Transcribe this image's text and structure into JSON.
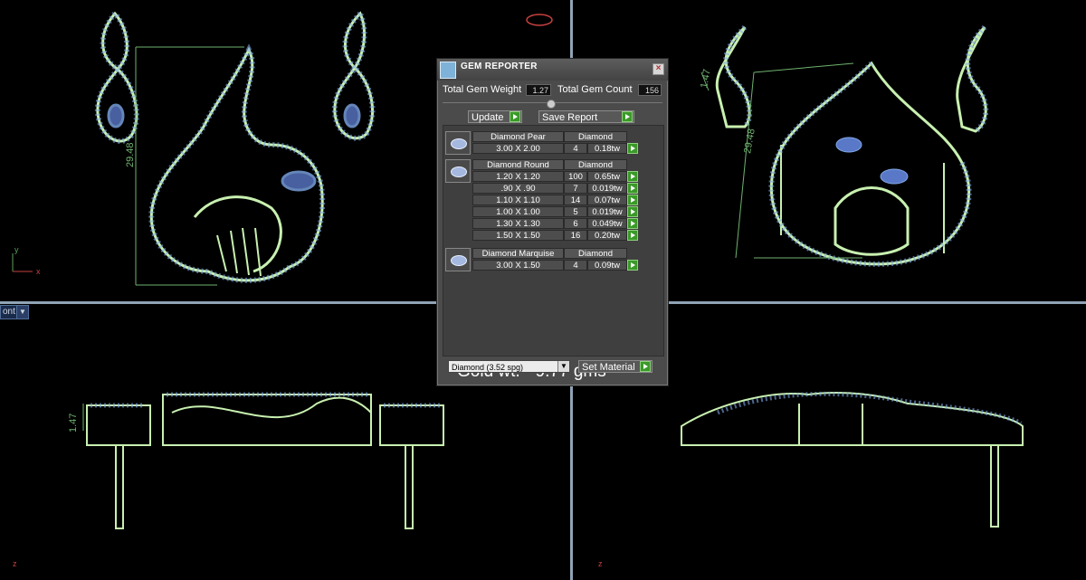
{
  "viewport": {
    "label": "ont",
    "axis_y": "y",
    "axis_x": "x",
    "axis_z": "z",
    "dim_tl": "29.48",
    "dim_tr_height": "29.48",
    "dim_tr_depth": "1.47",
    "dim_bl": "1.47"
  },
  "dialog": {
    "title": "GEM REPORTER",
    "total_weight_label": "Total Gem Weight",
    "total_weight": "1.27",
    "total_count_label": "Total Gem Count",
    "total_count": "156",
    "update_label": "Update",
    "save_report_label": "Save Report",
    "groups": [
      {
        "icon": "pear-gem-icon",
        "name": "Diamond Pear",
        "material": "Diamond",
        "rows": [
          {
            "size": "3.00 X 2.00",
            "count": "4",
            "weight": "0.18tw"
          }
        ]
      },
      {
        "icon": "round-gem-icon",
        "name": "Diamond Round",
        "material": "Diamond",
        "rows": [
          {
            "size": "1.20 X 1.20",
            "count": "100",
            "weight": "0.65tw"
          },
          {
            "size": ".90 X .90",
            "count": "7",
            "weight": "0.019tw"
          },
          {
            "size": "1.10 X 1.10",
            "count": "14",
            "weight": "0.07tw"
          },
          {
            "size": "1.00 X 1.00",
            "count": "5",
            "weight": "0.019tw"
          },
          {
            "size": "1.30 X 1.30",
            "count": "6",
            "weight": "0.049tw"
          },
          {
            "size": "1.50 X 1.50",
            "count": "16",
            "weight": "0.20tw"
          }
        ]
      },
      {
        "icon": "marquise-gem-icon",
        "name": "Diamond Marquise",
        "material": "Diamond",
        "rows": [
          {
            "size": "3.00 X 1.50",
            "count": "4",
            "weight": "0.09tw"
          }
        ]
      }
    ],
    "note": "Gold wt. - 9.77 gms",
    "material_select": "Diamond     (3.52 spg)",
    "set_material_label": "Set Material"
  },
  "colors": {
    "model_green": "#c8f0b0",
    "gem_blue": "#7fa8e8",
    "dimension_green": "#6fb26f",
    "divider": "#8fa3b5"
  }
}
